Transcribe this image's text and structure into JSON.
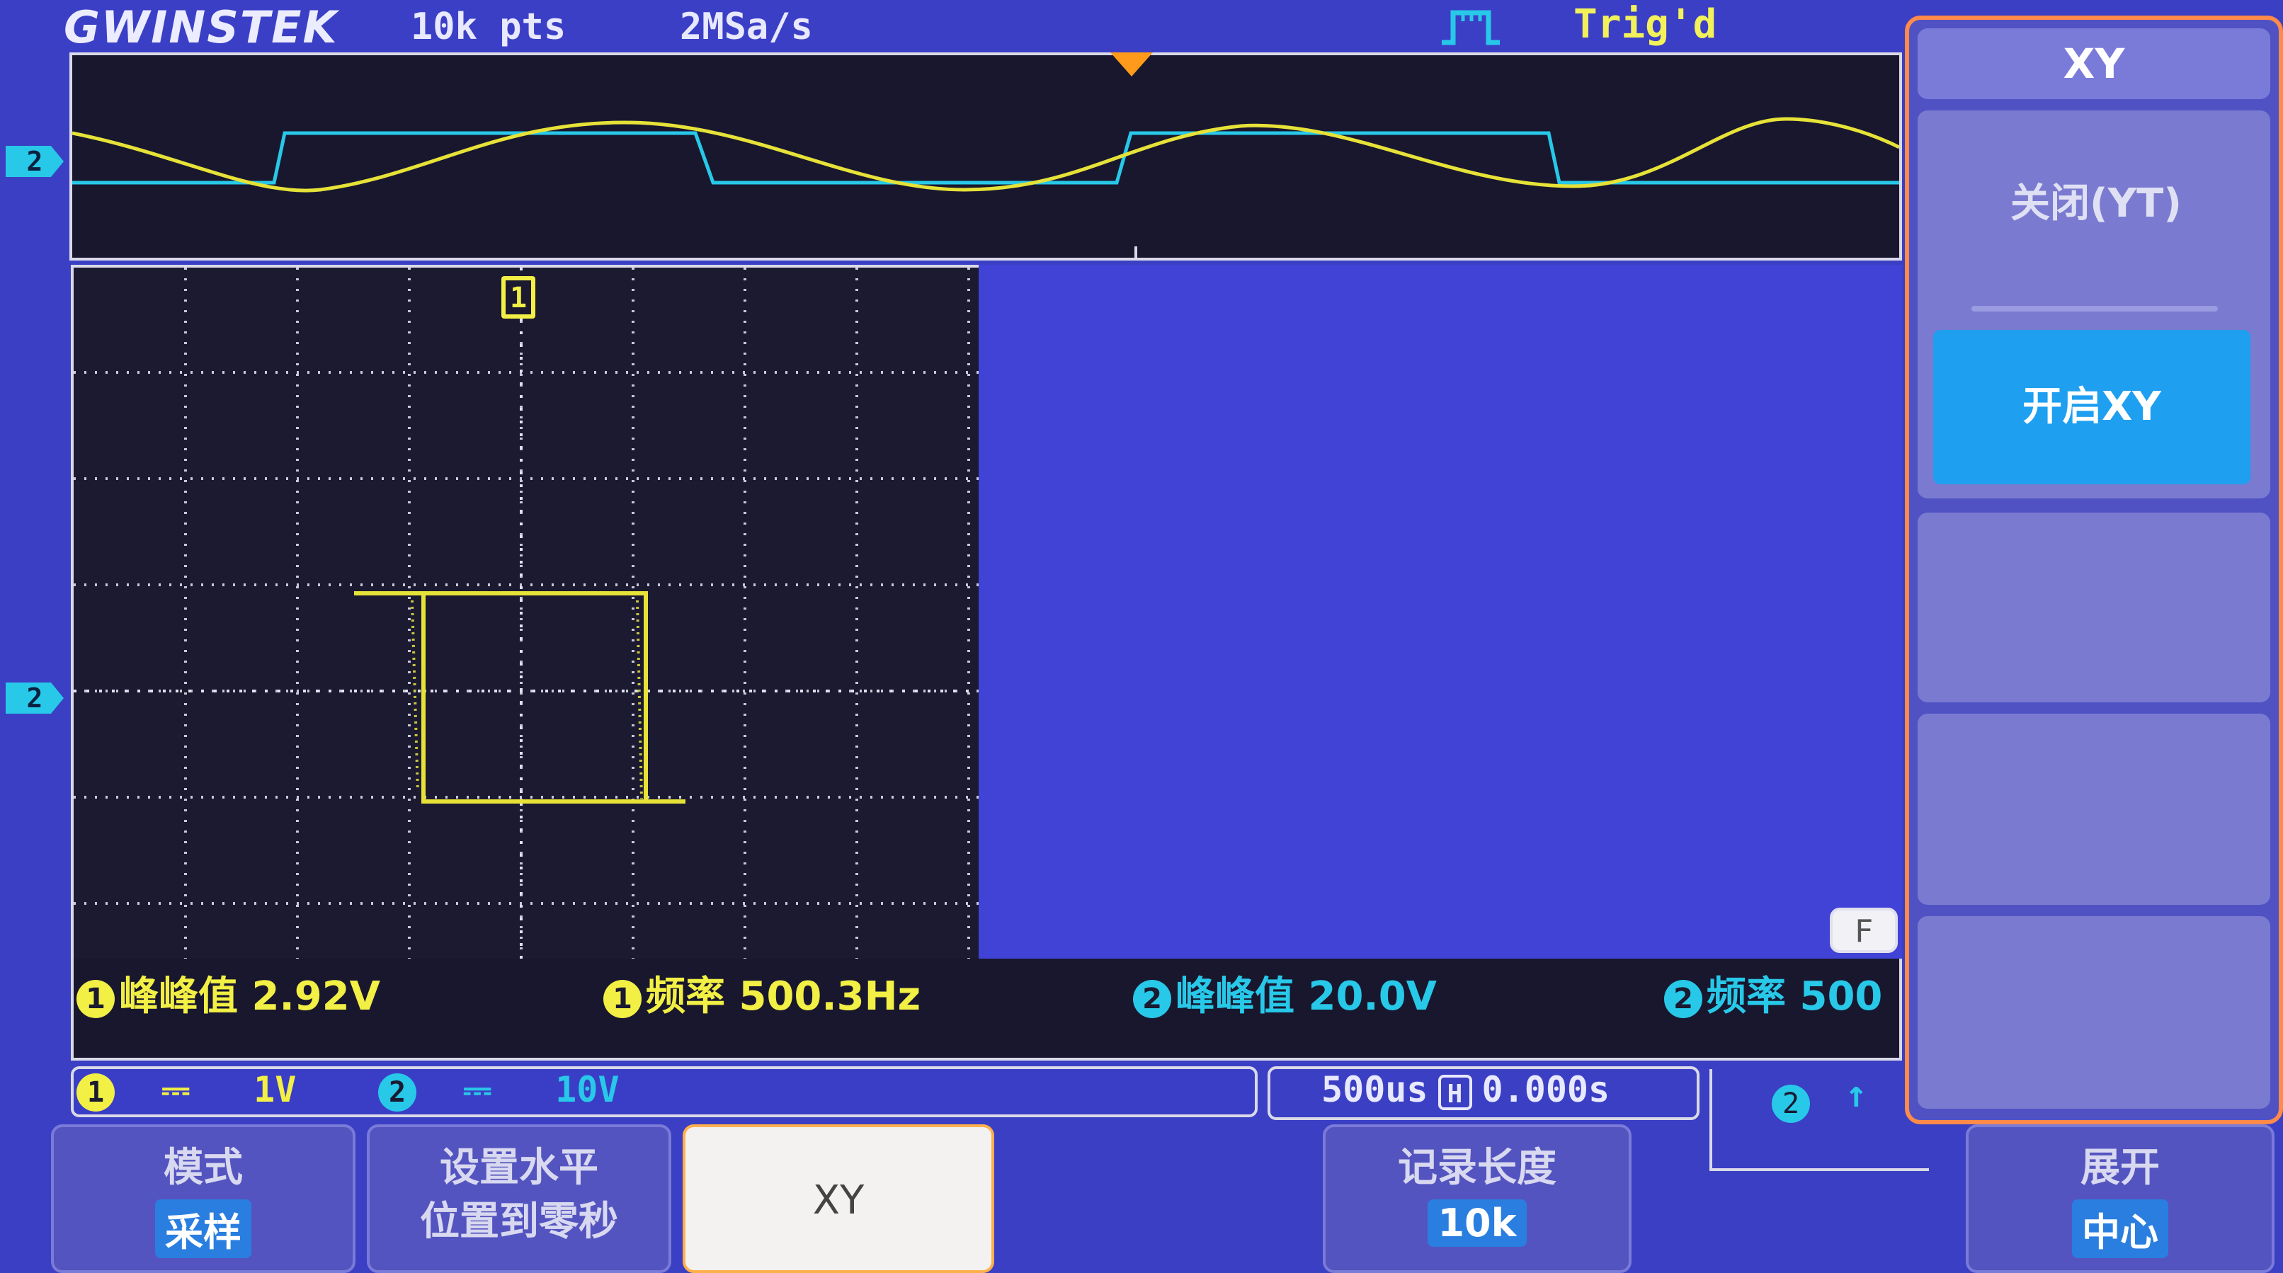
{
  "header": {
    "brand": "GWINSTEK",
    "record_points": "10k pts",
    "sample_rate": "2MSa/s",
    "trigger_status": "Trig'd",
    "trigger_icon": "pulse-trigger-icon"
  },
  "channel_markers": {
    "ch2_overview": "2",
    "ch2_grid": "2"
  },
  "grid": {
    "channel_label": "1"
  },
  "measurements": {
    "ch1_index": "1",
    "ch1_vpp_label": "峰峰值",
    "ch1_vpp_value": "2.92V",
    "ch1_freq_label": "频率",
    "ch1_freq_value": "500.3Hz",
    "ch2_index": "2",
    "ch2_vpp_label": "峰峰值",
    "ch2_vpp_value": "20.0V",
    "ch2_freq_label": "频率",
    "ch2_freq_value": "500"
  },
  "channel_status": {
    "ch1_index": "1",
    "ch1_coupling": "⎓",
    "ch1_scale": "1V",
    "ch2_index": "2",
    "ch2_coupling": "⎓",
    "ch2_scale": "10V"
  },
  "timebase": {
    "time_div": "500us",
    "h_icon": "H",
    "position": "0.000s"
  },
  "trigger_info": {
    "source": "2",
    "slope": "↑"
  },
  "f_button": "F",
  "bottom_menu": {
    "mode_label": "模式",
    "mode_value": "采样",
    "set_horizontal_line1": "设置水平",
    "set_horizontal_line2": "位置到零秒",
    "xy_label": "XY",
    "record_length_label": "记录长度",
    "record_length_value": "10k",
    "expand_label": "展开",
    "expand_value": "中心"
  },
  "side_menu": {
    "title": "XY",
    "option_off": "关闭(YT)",
    "option_on": "开启XY"
  },
  "colors": {
    "ch1": "#f2ef45",
    "ch2": "#28c8e8",
    "screen_bg": "#3a3fc4",
    "selected": "#1e9ff0",
    "panel_border": "#ff8a4a"
  }
}
